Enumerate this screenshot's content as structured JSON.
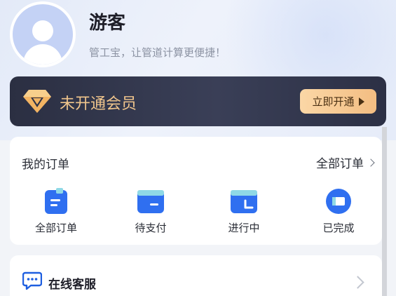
{
  "profile": {
    "name": "游客",
    "slogan": "管工宝，让管道计算更便捷！"
  },
  "vip": {
    "status_text": "未开通会员",
    "action_label": "立即开通",
    "colors": {
      "text": "#f0c58c",
      "button": "#f7c890",
      "background": "#2f3348"
    }
  },
  "orders": {
    "title": "我的订单",
    "view_all_label": "全部订单",
    "items": [
      {
        "label": "全部订单",
        "icon": "order-list-icon"
      },
      {
        "label": "待支付",
        "icon": "wallet-icon"
      },
      {
        "label": "进行中",
        "icon": "in-progress-icon"
      },
      {
        "label": "已完成",
        "icon": "completed-icon"
      }
    ],
    "accent_color": "#2f6ff0"
  },
  "service": {
    "label": "在线客服",
    "icon": "chat-bubble-icon"
  }
}
